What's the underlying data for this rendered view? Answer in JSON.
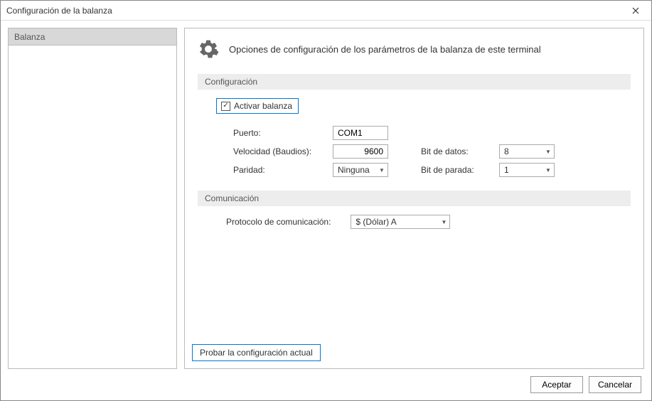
{
  "window": {
    "title": "Configuración de la balanza"
  },
  "sidebar": {
    "items": [
      {
        "label": "Balanza"
      }
    ]
  },
  "header": {
    "text": "Opciones de configuración de los parámetros de la balanza de este terminal"
  },
  "sections": {
    "config": {
      "title": "Configuración",
      "activate_label": "Activar balanza",
      "activate_checked": true,
      "port_label": "Puerto:",
      "port_value": "COM1",
      "baud_label": "Velocidad (Baudios):",
      "baud_value": "9600",
      "databits_label": "Bit de datos:",
      "databits_value": "8",
      "parity_label": "Paridad:",
      "parity_value": "Ninguna",
      "stopbits_label": "Bit de parada:",
      "stopbits_value": "1"
    },
    "comm": {
      "title": "Comunicación",
      "protocol_label": "Protocolo de comunicación:",
      "protocol_value": "$ (Dólar) A"
    }
  },
  "actions": {
    "test": "Probar la configuración actual",
    "accept": "Aceptar",
    "cancel": "Cancelar"
  }
}
